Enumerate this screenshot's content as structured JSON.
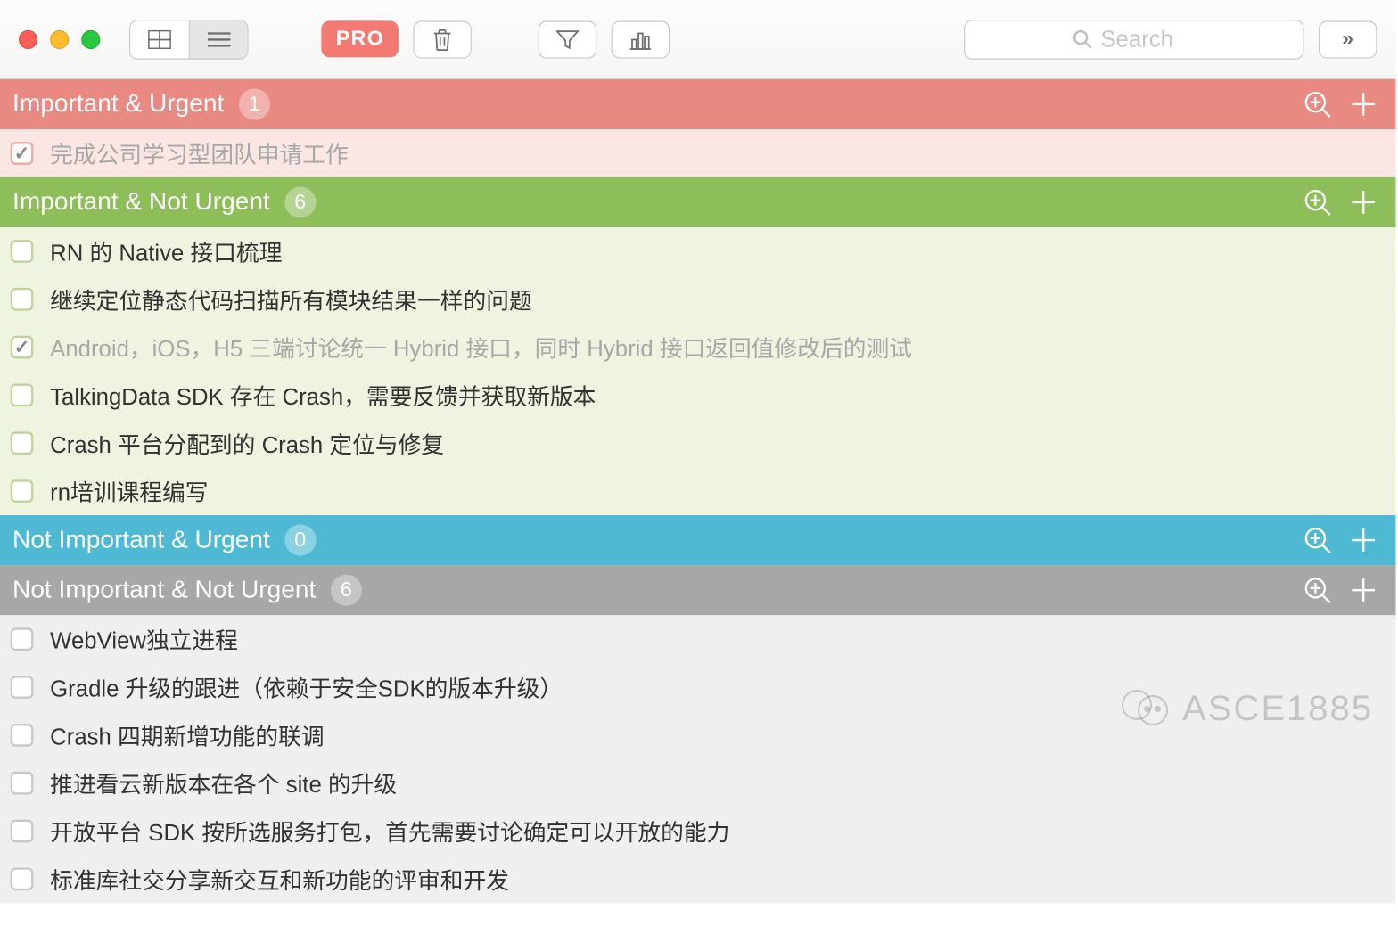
{
  "toolbar": {
    "pro_label": "PRO",
    "search_placeholder": "Search",
    "more_label": "»"
  },
  "sections": [
    {
      "title": "Important & Urgent",
      "count": "1",
      "color": "red",
      "tasks": [
        {
          "text": "完成公司学习型团队申请工作",
          "done": true
        }
      ]
    },
    {
      "title": "Important & Not Urgent",
      "count": "6",
      "color": "green",
      "tasks": [
        {
          "text": "RN 的 Native 接口梳理",
          "done": false
        },
        {
          "text": "继续定位静态代码扫描所有模块结果一样的问题",
          "done": false
        },
        {
          "text": "Android，iOS，H5 三端讨论统一 Hybrid 接口，同时 Hybrid 接口返回值修改后的测试",
          "done": true
        },
        {
          "text": "TalkingData SDK 存在 Crash，需要反馈并获取新版本",
          "done": false
        },
        {
          "text": "Crash 平台分配到的 Crash 定位与修复",
          "done": false
        },
        {
          "text": "rn培训课程编写",
          "done": false
        }
      ]
    },
    {
      "title": "Not Important & Urgent",
      "count": "0",
      "color": "blue",
      "tasks": []
    },
    {
      "title": "Not Important & Not Urgent",
      "count": "6",
      "color": "gray",
      "tasks": [
        {
          "text": "WebView独立进程",
          "done": false
        },
        {
          "text": "Gradle 升级的跟进（依赖于安全SDK的版本升级）",
          "done": false
        },
        {
          "text": "Crash 四期新增功能的联调",
          "done": false
        },
        {
          "text": "推进看云新版本在各个 site 的升级",
          "done": false
        },
        {
          "text": "开放平台 SDK 按所选服务打包，首先需要讨论确定可以开放的能力",
          "done": false
        },
        {
          "text": "标准库社交分享新交互和新功能的评审和开发",
          "done": false
        }
      ]
    }
  ],
  "watermark": "ASCE1885"
}
